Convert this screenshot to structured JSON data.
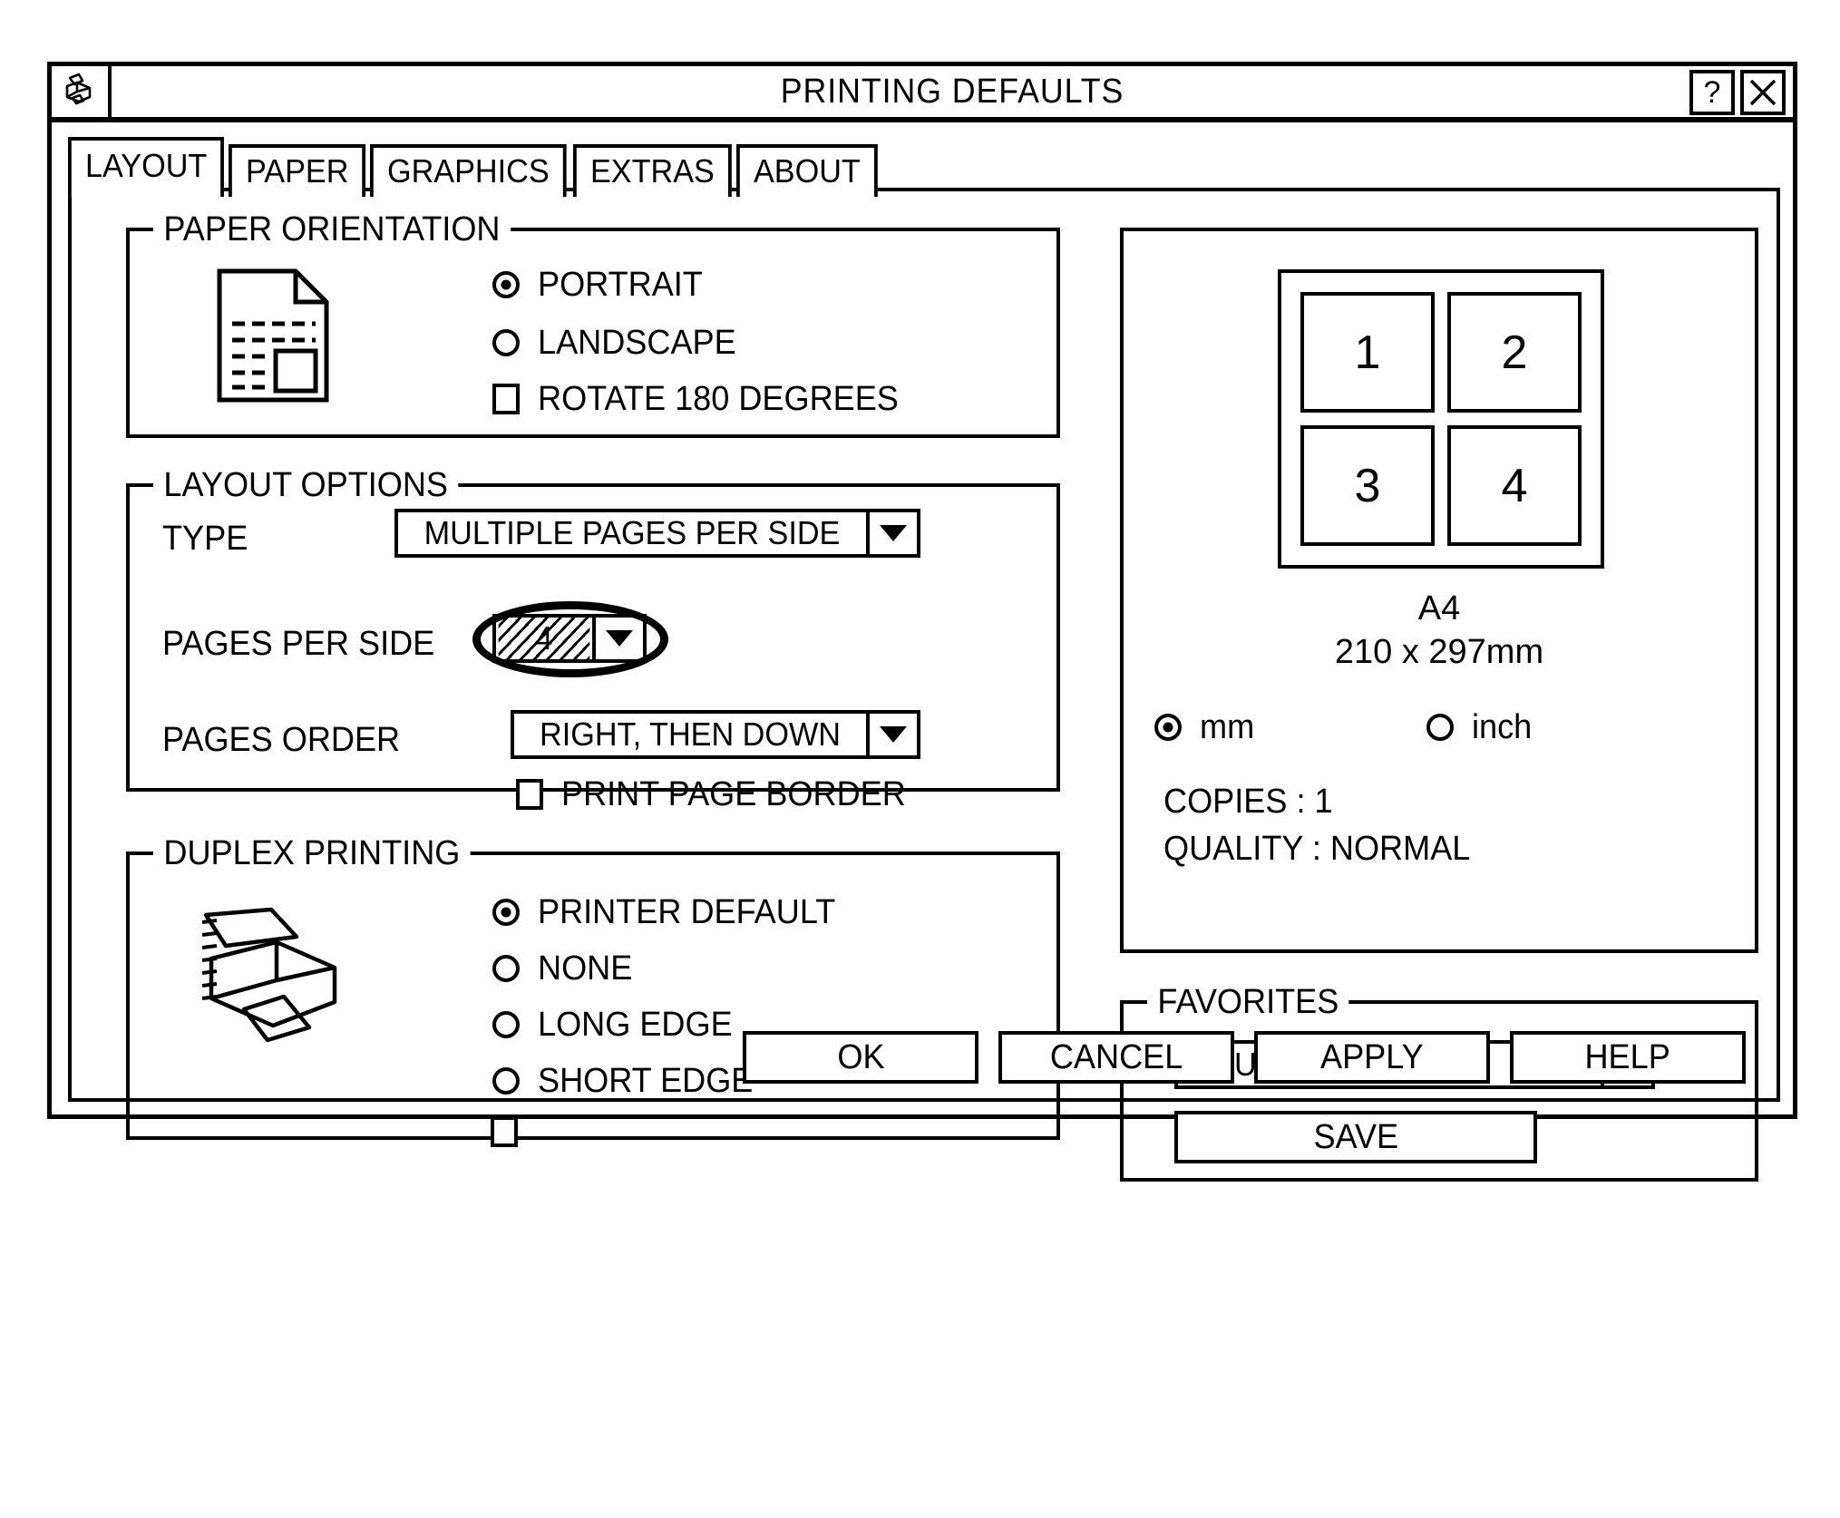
{
  "window": {
    "title": "PRINTING DEFAULTS",
    "sysmenu_icon": "printer-icon",
    "help_button": "?",
    "close_button": "✕"
  },
  "tabs": [
    {
      "label": "LAYOUT",
      "active": true
    },
    {
      "label": "PAPER",
      "active": false
    },
    {
      "label": "GRAPHICS",
      "active": false
    },
    {
      "label": "EXTRAS",
      "active": false
    },
    {
      "label": "ABOUT",
      "active": false
    }
  ],
  "paper_orientation": {
    "legend": "PAPER ORIENTATION",
    "options": [
      {
        "label": "PORTRAIT",
        "selected": true
      },
      {
        "label": "LANDSCAPE",
        "selected": false
      }
    ],
    "rotate": {
      "label": "ROTATE 180 DEGREES",
      "checked": false
    }
  },
  "layout_options": {
    "legend": "LAYOUT OPTIONS",
    "type": {
      "label": "TYPE",
      "value": "MULTIPLE PAGES PER SIDE"
    },
    "pages_per_side": {
      "label": "PAGES PER SIDE",
      "value": "4",
      "highlighted": true,
      "annotation": "hand-drawn-oval"
    },
    "pages_order": {
      "label": "PAGES ORDER",
      "value": "RIGHT, THEN DOWN"
    },
    "print_page_border": {
      "label": "PRINT PAGE BORDER",
      "checked": false
    }
  },
  "duplex_printing": {
    "legend": "DUPLEX PRINTING",
    "options": [
      {
        "label": "PRINTER DEFAULT",
        "selected": true
      },
      {
        "label": "NONE",
        "selected": false
      },
      {
        "label": "LONG EDGE",
        "selected": false
      },
      {
        "label": "SHORT EDGE",
        "selected": false
      }
    ],
    "extra_checkbox": {
      "label": "",
      "checked": false
    }
  },
  "preview": {
    "pages": [
      "1",
      "2",
      "3",
      "4"
    ],
    "paper_name": "A4",
    "paper_size": "210 x 297mm",
    "units": [
      {
        "label": "mm",
        "selected": true
      },
      {
        "label": "inch",
        "selected": false
      }
    ],
    "copies": "COPIES : 1",
    "quality": "QUALITY : NORMAL"
  },
  "favorites": {
    "legend": "FAVORITES",
    "value": "< UNTITLED >",
    "save_label": "SAVE"
  },
  "footer_buttons": [
    {
      "label": "OK"
    },
    {
      "label": "CANCEL"
    },
    {
      "label": "APPLY"
    },
    {
      "label": "HELP"
    }
  ]
}
